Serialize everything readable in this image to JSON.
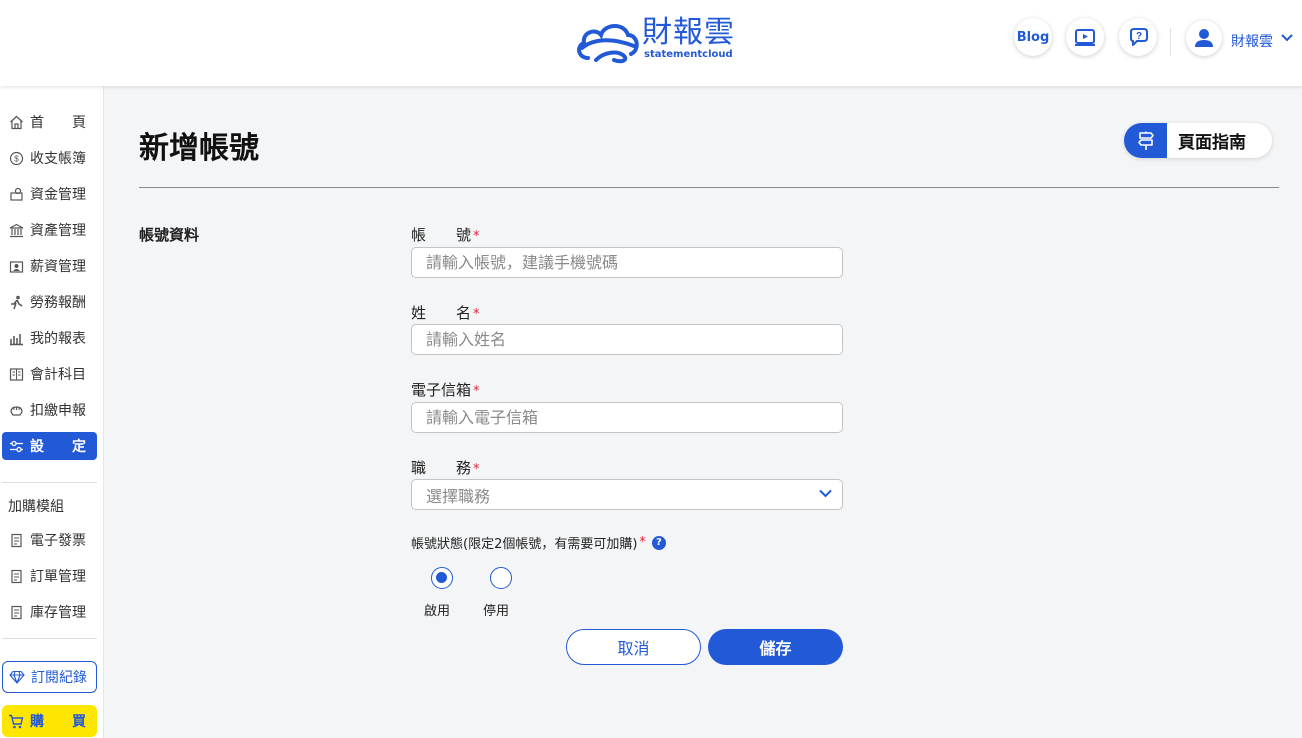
{
  "brand": {
    "name_cn": "財報雲",
    "name_en": "statementcloud",
    "color": "#2259d6"
  },
  "header": {
    "blog_label": "Blog",
    "video_icon": "video-icon",
    "help_icon": "chat-help-icon",
    "user_name": "財報雲"
  },
  "sidebar": {
    "items": [
      {
        "label": "首　　頁",
        "icon": "home-icon"
      },
      {
        "label": "收支帳簿",
        "icon": "coin-icon"
      },
      {
        "label": "資金管理",
        "icon": "fund-icon"
      },
      {
        "label": "資產管理",
        "icon": "bank-icon"
      },
      {
        "label": "薪資管理",
        "icon": "payroll-icon"
      },
      {
        "label": "勞務報酬",
        "icon": "labor-icon"
      },
      {
        "label": "我的報表",
        "icon": "chart-icon"
      },
      {
        "label": "會計科目",
        "icon": "ledger-icon"
      },
      {
        "label": "扣繳申報",
        "icon": "tax-icon"
      },
      {
        "label": "設　　定",
        "icon": "settings-icon",
        "active": true
      }
    ],
    "addon_title": "加購模組",
    "addon_items": [
      {
        "label": "電子發票",
        "icon": "invoice-icon"
      },
      {
        "label": "訂單管理",
        "icon": "order-icon"
      },
      {
        "label": "庫存管理",
        "icon": "inventory-icon"
      }
    ],
    "subscription_label": "訂閱紀錄",
    "buy_label": "購　　買"
  },
  "page": {
    "title": "新增帳號",
    "guide_label": "頁面指南",
    "section_label": "帳號資料"
  },
  "form": {
    "account": {
      "label": "帳　　號",
      "placeholder": "請輸入帳號，建議手機號碼",
      "value": ""
    },
    "name": {
      "label": "姓　　名",
      "placeholder": "請輸入姓名",
      "value": ""
    },
    "email": {
      "label": "電子信箱",
      "placeholder": "請輸入電子信箱",
      "value": ""
    },
    "role": {
      "label": "職　　務",
      "placeholder": "選擇職務"
    },
    "status_label": "帳號狀態(限定2個帳號，有需要可加購)",
    "required_mark": "*",
    "help_mark": "?",
    "status_options": [
      {
        "label": "啟用",
        "checked": true
      },
      {
        "label": "停用",
        "checked": false
      }
    ]
  },
  "actions": {
    "cancel_label": "取消",
    "save_label": "儲存"
  }
}
